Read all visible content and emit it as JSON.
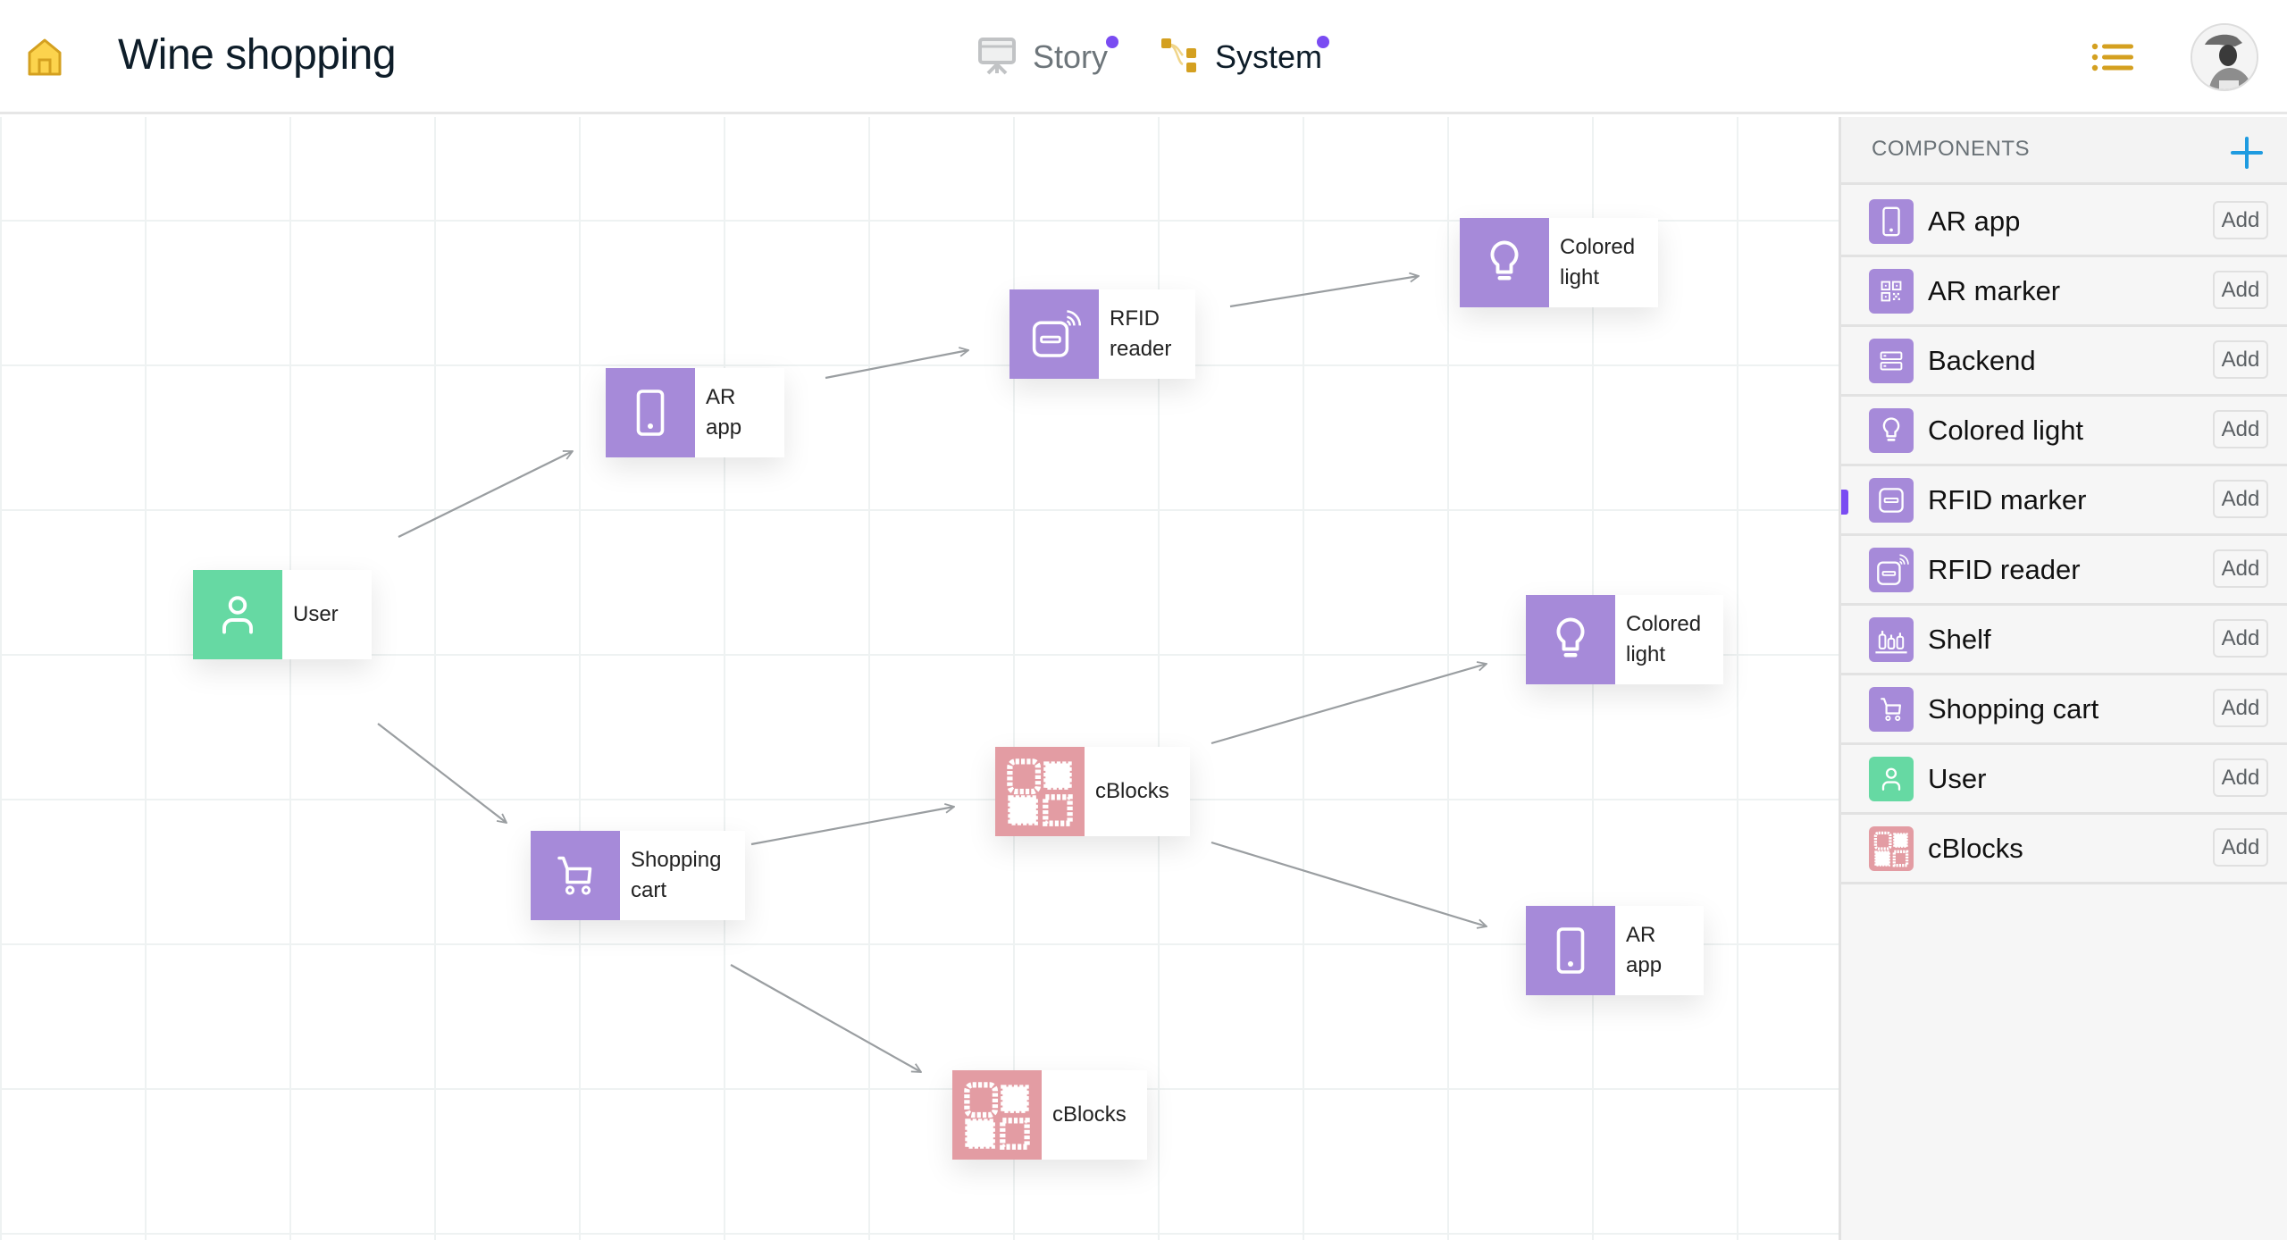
{
  "header": {
    "title": "Wine shopping",
    "home_icon": "home-icon",
    "tabs": [
      {
        "label": "Story",
        "icon": "presentation-board-icon",
        "active": false,
        "has_notification": true
      },
      {
        "label": "System",
        "icon": "system-tree-icon",
        "active": true,
        "has_notification": true
      }
    ],
    "menu_icon": "list-icon",
    "avatar": "user-avatar"
  },
  "colors": {
    "component_purple": "#a68ad9",
    "user_green": "#66d9a3",
    "cblocks_pink": "#e39ca3",
    "notification_dot": "#7a4cf2",
    "accent_gold": "#d4a020",
    "add_blue": "#1e9be0"
  },
  "canvas": {
    "nodes": [
      {
        "id": "n-user",
        "label": "User",
        "icon": "user-icon",
        "color": "green"
      },
      {
        "id": "n-arapp1",
        "label": "AR\napp",
        "icon": "smartphone-icon",
        "color": "purple"
      },
      {
        "id": "n-rfid",
        "label": "RFID\nreader",
        "icon": "rfid-reader-icon",
        "color": "purple"
      },
      {
        "id": "n-light1",
        "label": "Colored\nlight",
        "icon": "lightbulb-icon",
        "color": "purple"
      },
      {
        "id": "n-cart",
        "label": "Shopping\ncart",
        "icon": "shopping-cart-icon",
        "color": "purple"
      },
      {
        "id": "n-cblocks1",
        "label": "cBlocks",
        "icon": "cblocks-icon",
        "color": "pink"
      },
      {
        "id": "n-light2",
        "label": "Colored\nlight",
        "icon": "lightbulb-icon",
        "color": "purple"
      },
      {
        "id": "n-arapp2",
        "label": "AR\napp",
        "icon": "smartphone-icon",
        "color": "purple"
      },
      {
        "id": "n-cblocks2",
        "label": "cBlocks",
        "icon": "cblocks-icon",
        "color": "pink"
      }
    ],
    "edges": [
      {
        "from": "User",
        "to": "AR app"
      },
      {
        "from": "User",
        "to": "Shopping cart"
      },
      {
        "from": "AR app",
        "to": "RFID reader"
      },
      {
        "from": "RFID reader",
        "to": "Colored light"
      },
      {
        "from": "Shopping cart",
        "to": "cBlocks"
      },
      {
        "from": "Shopping cart",
        "to": "cBlocks (2)"
      },
      {
        "from": "cBlocks",
        "to": "Colored light (2)"
      },
      {
        "from": "cBlocks",
        "to": "AR app (2)"
      }
    ]
  },
  "sidebar": {
    "title": "COMPONENTS",
    "add_icon": "plus-icon",
    "items": [
      {
        "label": "AR app",
        "icon": "smartphone-icon",
        "color": "purple",
        "action": "Add",
        "selected": false
      },
      {
        "label": "AR marker",
        "icon": "qr-code-icon",
        "color": "purple",
        "action": "Add",
        "selected": false
      },
      {
        "label": "Backend",
        "icon": "server-icon",
        "color": "purple",
        "action": "Add",
        "selected": false
      },
      {
        "label": "Colored light",
        "icon": "lightbulb-icon",
        "color": "purple",
        "action": "Add",
        "selected": false
      },
      {
        "label": "RFID marker",
        "icon": "rfid-marker-icon",
        "color": "purple",
        "action": "Add",
        "selected": true
      },
      {
        "label": "RFID reader",
        "icon": "rfid-reader-icon",
        "color": "purple",
        "action": "Add",
        "selected": false
      },
      {
        "label": "Shelf",
        "icon": "shelf-icon",
        "color": "purple",
        "action": "Add",
        "selected": false
      },
      {
        "label": "Shopping cart",
        "icon": "shopping-cart-icon",
        "color": "purple",
        "action": "Add",
        "selected": false
      },
      {
        "label": "User",
        "icon": "user-icon",
        "color": "green",
        "action": "Add",
        "selected": false
      },
      {
        "label": "cBlocks",
        "icon": "cblocks-icon",
        "color": "pink",
        "action": "Add",
        "selected": false
      }
    ]
  }
}
